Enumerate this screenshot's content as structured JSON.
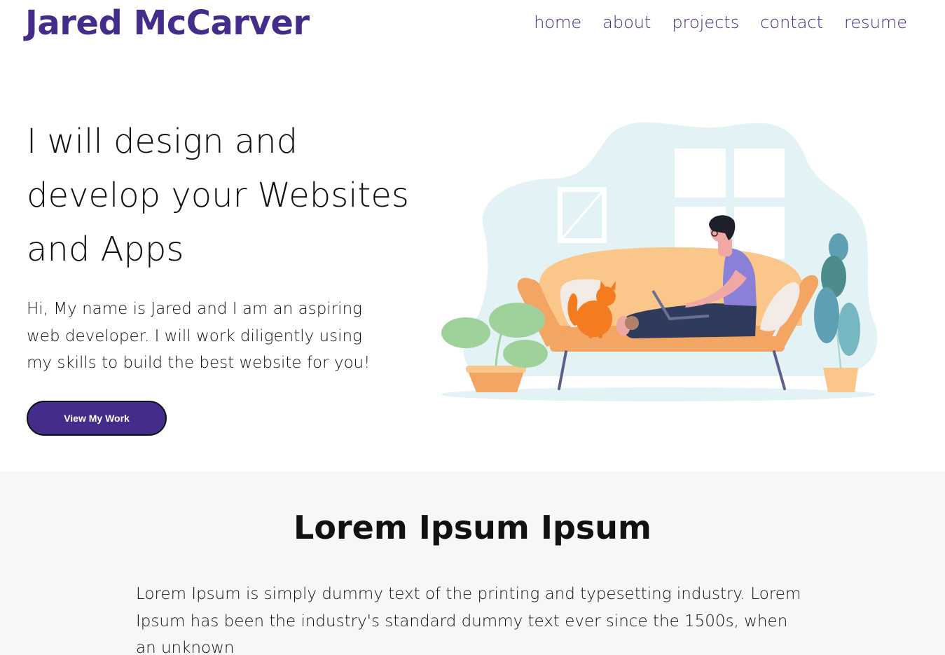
{
  "header": {
    "brand": "Jared McCarver",
    "nav": [
      {
        "label": "home"
      },
      {
        "label": "about"
      },
      {
        "label": "projects"
      },
      {
        "label": "contact"
      },
      {
        "label": "resume"
      }
    ]
  },
  "hero": {
    "headline": "I will design and develop your Websites and Apps",
    "intro": "Hi, My name is Jared and I am an aspiring web developer. I will work diligently using my skills to build the best website for you!",
    "cta_label": "View My Work",
    "illustration": {
      "icon": "person-on-couch-with-laptop-and-cat-illustration",
      "colors": {
        "blob": "#e3f3f5",
        "couch": "#fbc68a",
        "couch_dark": "#f3a563",
        "shirt": "#8b80d8",
        "pants": "#2e3b5c",
        "cat": "#f47c20",
        "leaf_green": "#9ed29a",
        "leaf_teal": "#4c8d8c"
      }
    }
  },
  "section2": {
    "title": "Lorem Ipsum Ipsum",
    "body": "Lorem Ipsum is simply dummy text of the printing and typesetting industry. Lorem Ipsum has been the industry's standard dummy text ever since the 1500s, when an unknown"
  },
  "colors": {
    "accent": "#432c8a",
    "section_bg": "#f7f7f7"
  }
}
